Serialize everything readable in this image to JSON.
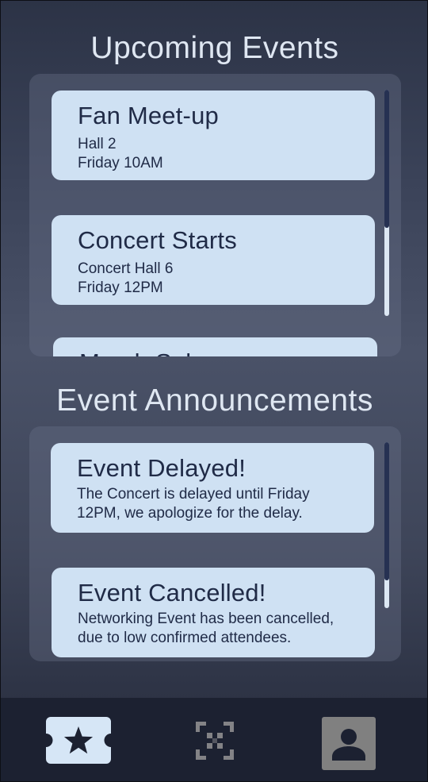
{
  "upcoming": {
    "title": "Upcoming Events",
    "events": [
      {
        "name": "Fan Meet-up",
        "location": "Hall 2",
        "time": "Friday 10AM"
      },
      {
        "name": "Concert Starts",
        "location": "Concert Hall 6",
        "time": "Friday 12PM"
      },
      {
        "name": "Merch Sales"
      }
    ],
    "scroll_position": 0.0
  },
  "announcements": {
    "title": "Event Announcements",
    "items": [
      {
        "title": "Event Delayed!",
        "line1": "The Concert is delayed until Friday",
        "line2": "12PM, we apologize for the delay."
      },
      {
        "title": "Event Cancelled!",
        "line1": "Networking Event has been cancelled,",
        "line2": "due to low confirmed attendees."
      }
    ],
    "scroll_position": 0.0
  },
  "nav": {
    "items": [
      {
        "icon": "ticket-star-icon",
        "selected": true
      },
      {
        "icon": "qr-scan-icon",
        "selected": false
      },
      {
        "icon": "profile-icon",
        "selected": false
      }
    ]
  },
  "colors": {
    "card": "#cfe1f3",
    "card_text": "#202b47",
    "title_text": "#dfe7f2",
    "nav_bar": "#1c2131"
  }
}
